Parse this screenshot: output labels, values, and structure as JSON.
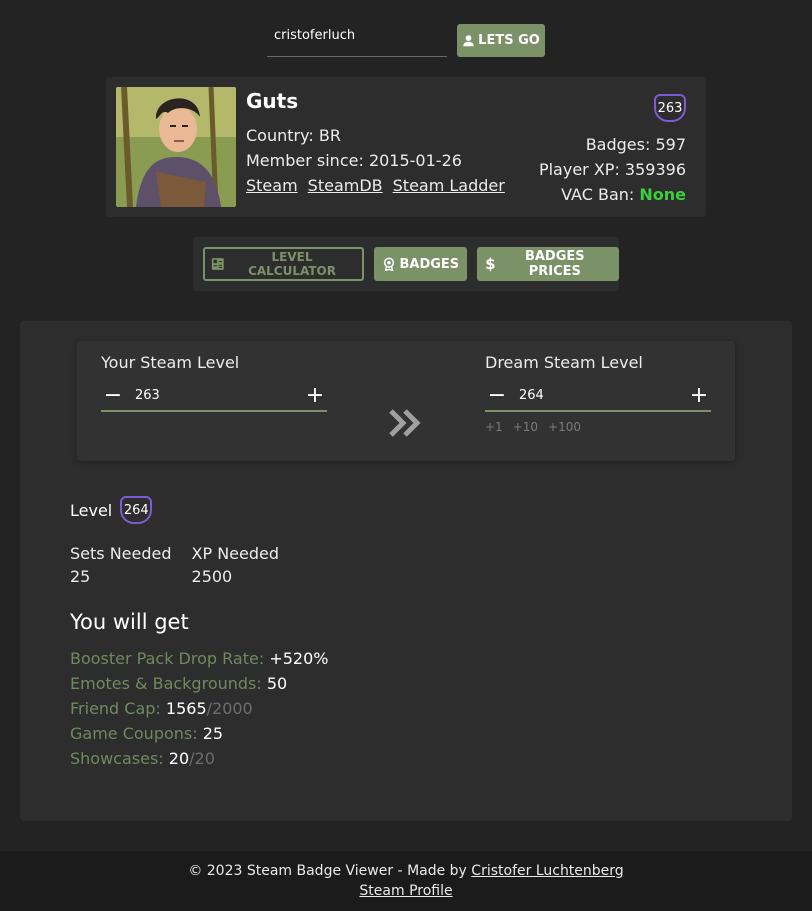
{
  "search": {
    "value": "cristoferluch",
    "button_label": "LETS GO"
  },
  "profile": {
    "name": "Guts",
    "country": "Country: BR",
    "member_since": "Member since: 2015-01-26",
    "links": [
      "Steam",
      "SteamDB",
      "Steam Ladder"
    ],
    "level": "263",
    "badges": "Badges: 597",
    "player_xp": "Player XP: 359396",
    "vac_label": "VAC Ban: ",
    "vac_value": "None"
  },
  "toolbar": {
    "level_calculator": "LEVEL CALCULATOR",
    "badges": "BADGES",
    "badges_prices": "BADGES PRICES"
  },
  "calculator": {
    "current_title": "Your Steam Level",
    "current_value": "263",
    "dream_title": "Dream Steam Level",
    "dream_value": "264",
    "quick_adds": [
      "+1",
      "+10",
      "+100"
    ]
  },
  "results": {
    "level_label": "Level",
    "level_value": "264",
    "sets_label": "Sets Needed",
    "sets_value": "25",
    "xp_label": "XP Needed",
    "xp_value": "2500",
    "you_will_get": "You will get",
    "booster_label": "Booster Pack Drop Rate:",
    "booster_value": "+520%",
    "emotes_label": "Emotes & Backgrounds:",
    "emotes_value": "50",
    "friend_label": "Friend Cap:",
    "friend_value": "1565",
    "friend_max": "/2000",
    "coupons_label": "Game Coupons:",
    "coupons_value": "25",
    "showcases_label": "Showcases:",
    "showcases_value": "20",
    "showcases_max": "/20"
  },
  "footer": {
    "text": "© 2023 Steam Badge Viewer - Made by ",
    "author": "Cristofer Luchtenberg",
    "profile_link": "Steam Profile"
  },
  "colors": {
    "accent": "#7b9167",
    "badge_border": "#7b5bd6",
    "vac_ok": "#3ccf3c",
    "bg": "#232323",
    "panel": "#2d2d2d"
  }
}
